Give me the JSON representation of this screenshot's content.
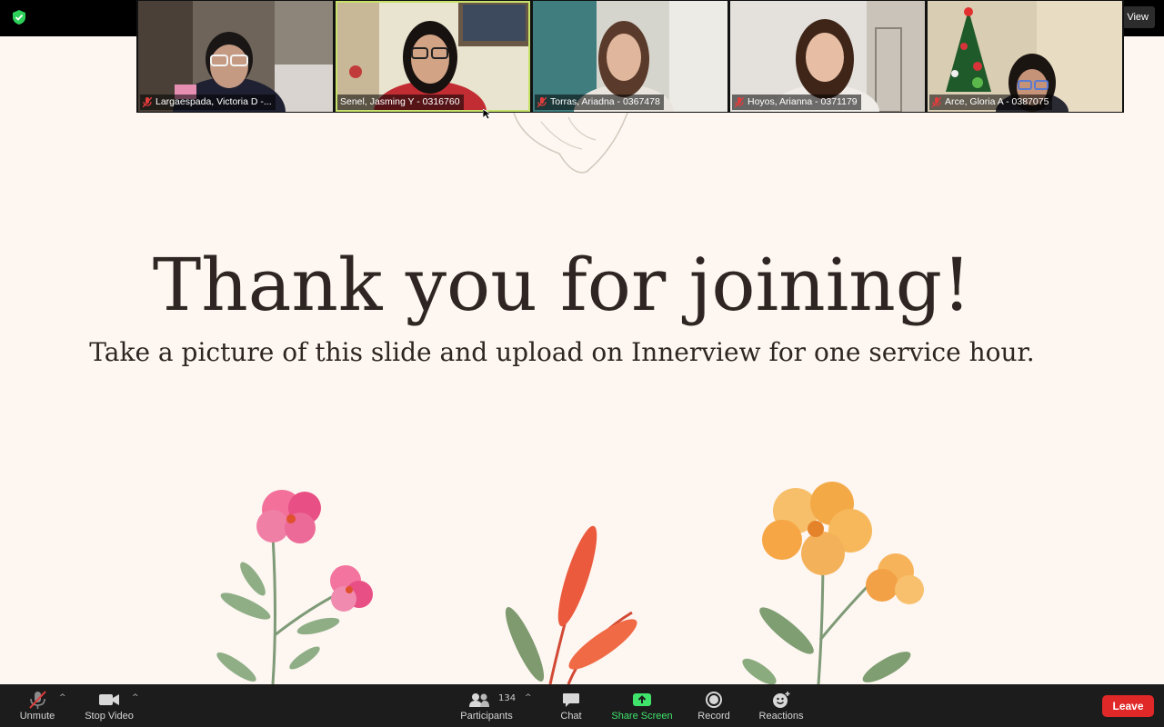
{
  "topbar": {
    "view_label": "View",
    "security_color": "#2dd15a"
  },
  "participants": [
    {
      "name": "Largaespada, Victoria D -...",
      "muted": true,
      "active": false
    },
    {
      "name": "Senel, Jasming Y - 0316760",
      "muted": false,
      "active": true
    },
    {
      "name": "Torras, Ariadna - 0367478",
      "muted": true,
      "active": false
    },
    {
      "name": "Hoyos, Arianna - 0371179",
      "muted": true,
      "active": false
    },
    {
      "name": "Arce, Gloria A - 0387075",
      "muted": true,
      "active": false
    }
  ],
  "slide": {
    "title": "Thank you for joining!",
    "subtitle": "Take a picture of this slide and upload on Innerview for one service hour."
  },
  "toolbar": {
    "unmute_label": "Unmute",
    "stop_video_label": "Stop Video",
    "participants_label": "Participants",
    "participants_count": "134",
    "chat_label": "Chat",
    "share_screen_label": "Share Screen",
    "record_label": "Record",
    "reactions_label": "Reactions",
    "leave_label": "Leave",
    "share_color": "#3fe36b",
    "leave_color": "#e02828"
  }
}
